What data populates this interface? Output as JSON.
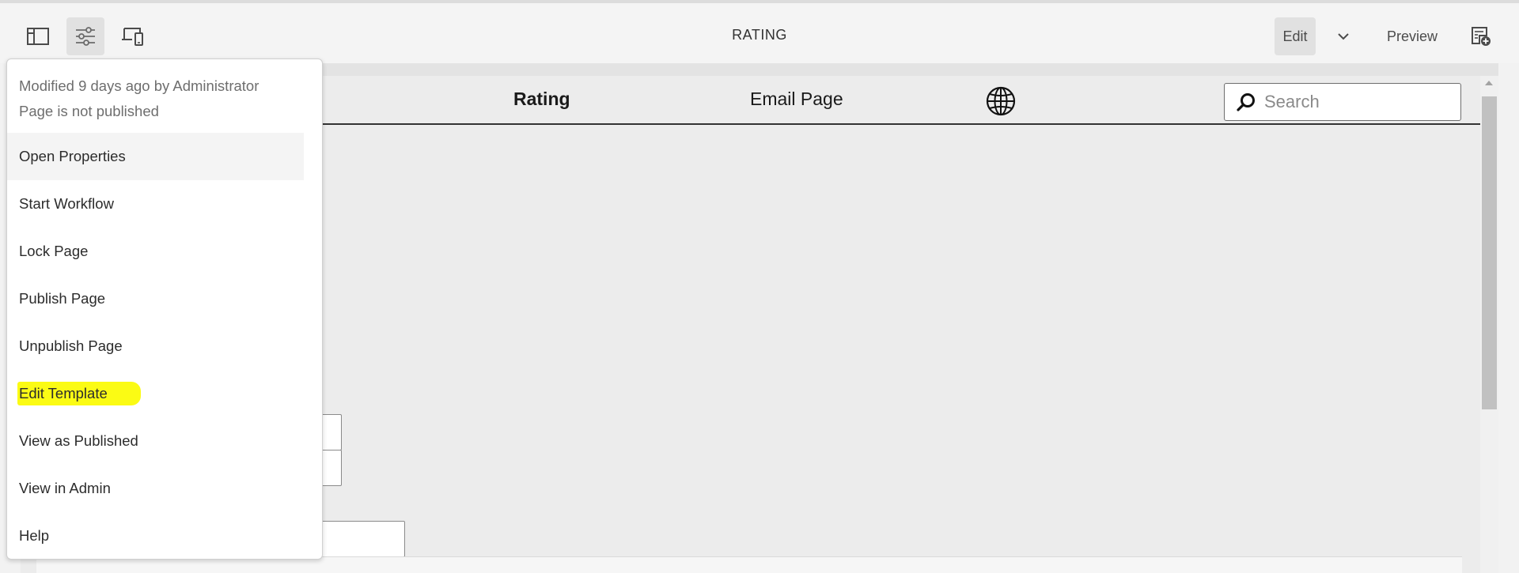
{
  "toolbar": {
    "title": "RATING",
    "edit_label": "Edit",
    "preview_label": "Preview",
    "icons": [
      "side-panel-icon",
      "page-properties-icon",
      "emulator-icon",
      "chevron-down-icon",
      "annotations-icon"
    ]
  },
  "site": {
    "nav": [
      "Rating",
      "Email Page"
    ],
    "search_placeholder": "Search"
  },
  "popover": {
    "modified": "Modified 9 days ago by Administrator",
    "status": "Page is not published",
    "items": [
      "Open Properties",
      "Start Workflow",
      "Lock Page",
      "Publish Page",
      "Unpublish Page",
      "Edit Template",
      "View as Published",
      "View in Admin",
      "Help"
    ],
    "highlight_color": "#fbfb14"
  }
}
